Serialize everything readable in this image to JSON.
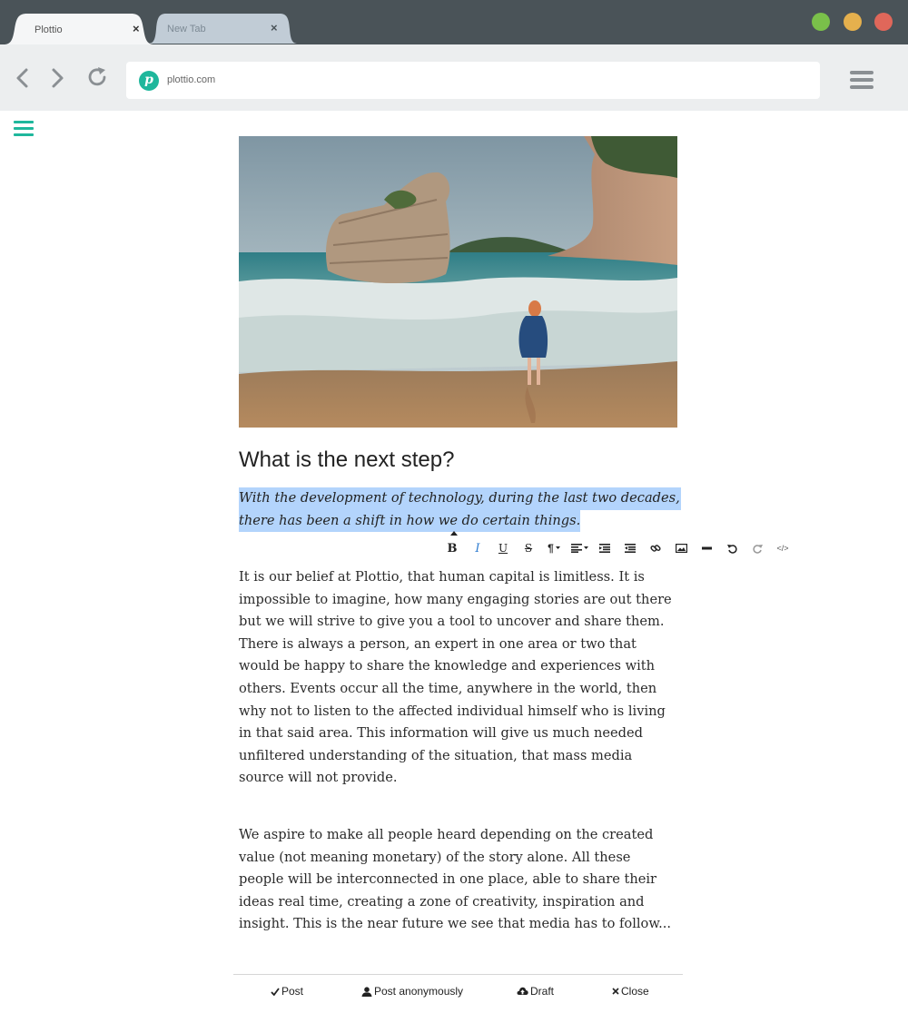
{
  "browser": {
    "tabs": [
      {
        "label": "Plottio",
        "active": true
      },
      {
        "label": "New Tab",
        "active": false
      }
    ],
    "tab_close_symbol": "×",
    "address": {
      "site_icon_letter": "p",
      "url": "plottio.com"
    },
    "window_controls": [
      "green",
      "yellow",
      "red"
    ],
    "icons": {
      "back": "chevron-left-icon",
      "forward": "chevron-right-icon",
      "reload": "reload-icon",
      "menu": "hamburger-menu-icon"
    }
  },
  "editor": {
    "title": "What is the next step?",
    "lead_lines": [
      "With the development of technology, during the last two decades,",
      "there has been a shift in how we do certain things."
    ],
    "format_toolbar": [
      {
        "name": "bold",
        "label": "B"
      },
      {
        "name": "italic",
        "label": "I",
        "active": true
      },
      {
        "name": "underline",
        "label": "U"
      },
      {
        "name": "strikethrough",
        "label": "S"
      },
      {
        "name": "paragraph",
        "label": "¶"
      },
      {
        "name": "align",
        "icon": "align-left-icon"
      },
      {
        "name": "indent",
        "icon": "indent-icon"
      },
      {
        "name": "outdent",
        "icon": "outdent-icon"
      },
      {
        "name": "link",
        "icon": "link-icon"
      },
      {
        "name": "image",
        "icon": "image-icon"
      },
      {
        "name": "horizontal-rule",
        "icon": "horizontal-rule-icon"
      },
      {
        "name": "undo",
        "icon": "undo-icon"
      },
      {
        "name": "redo",
        "icon": "redo-icon"
      },
      {
        "name": "source",
        "label": "</>"
      }
    ],
    "paragraph1_lines": [
      "It is our belief at Plottio, that human capital is limitless. It is",
      "impossible to imagine, how many engaging stories are out there",
      "but we will strive to give you a tool to uncover and share them.",
      "There is always a person, an expert in one area or two that",
      "would be happy to share the knowledge and experiences with",
      "others. Events occur all the time, anywhere in the world, then",
      "why not to listen to the affected individual himself who is living",
      "in that said area. This information will give us much needed",
      "unfiltered understanding of the situation, that mass media",
      "source will not provide."
    ],
    "paragraph2_lines": [
      "We aspire to make all people heard depending on the created",
      "value (not meaning monetary) of the story alone. All these",
      "people will be interconnected in one place, able to share their",
      "ideas real time, creating a zone of creativity, inspiration and",
      "insight. This is the near future we see that media has to follow..."
    ]
  },
  "actions": {
    "post": {
      "icon": "check-icon",
      "label": "Post"
    },
    "anonymous": {
      "icon": "user-icon",
      "label": "Post anonymously"
    },
    "draft": {
      "icon": "cloud-upload-icon",
      "label": "Draft"
    },
    "close": {
      "icon": "close-icon",
      "label": "Close"
    }
  },
  "colors": {
    "accent": "#1fb79c",
    "titlebar": "#4a5358",
    "toolbar": "#eceeef",
    "selection": "#b3d4fc",
    "italic_active": "#2f7dd0"
  }
}
